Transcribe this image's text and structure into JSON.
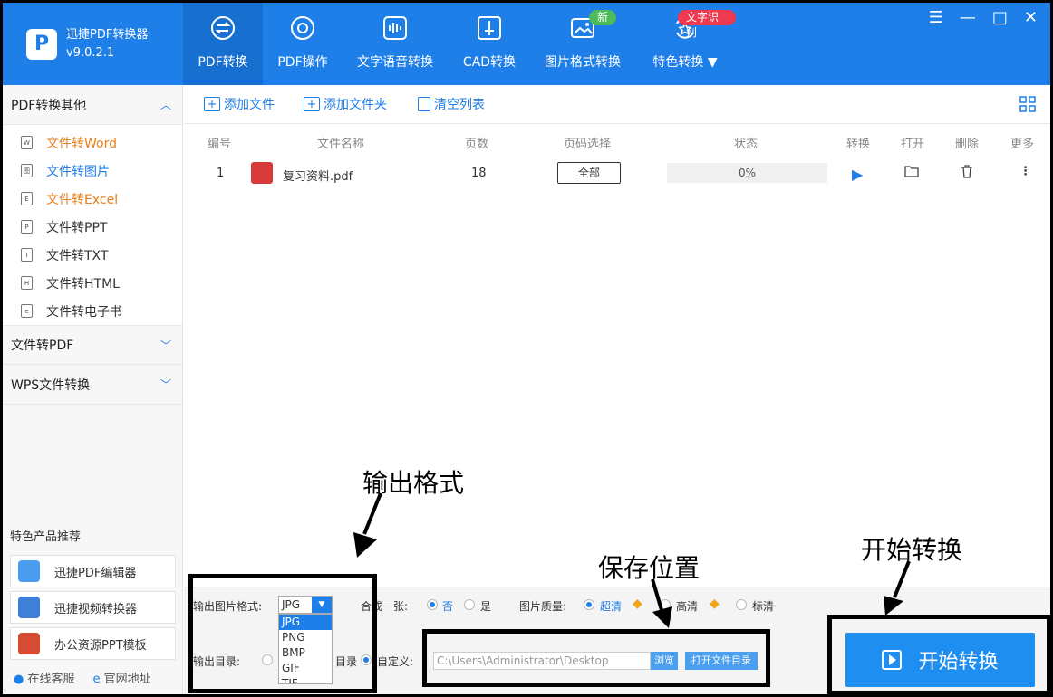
{
  "app": {
    "name": "迅捷PDF转换器",
    "version": "v9.0.2.1"
  },
  "nav": [
    {
      "label": "PDF转换",
      "icon": "pdf-convert-icon"
    },
    {
      "label": "PDF操作",
      "icon": "pdf-operate-icon"
    },
    {
      "label": "文字语音转换",
      "icon": "voice-wave-icon"
    },
    {
      "label": "CAD转换",
      "icon": "cad-icon"
    },
    {
      "label": "图片格式转换",
      "icon": "image-icon"
    },
    {
      "label": "特色转换",
      "icon": "star-convert-icon"
    }
  ],
  "badges": {
    "new": "新",
    "ocr": "文字识别"
  },
  "window_controls": {
    "menu": "☰",
    "minimize": "—",
    "maximize": "□",
    "close": "✕"
  },
  "sidebar": {
    "section1": "PDF转换其他",
    "items": [
      "文件转Word",
      "文件转图片",
      "文件转Excel",
      "文件转PPT",
      "文件转TXT",
      "文件转HTML",
      "文件转电子书"
    ],
    "item_icons": [
      "W",
      "图",
      "E",
      "P",
      "T",
      "H",
      "e"
    ],
    "section2": "文件转PDF",
    "section3": "WPS文件转换",
    "promo_title": "特色产品推荐",
    "promos": [
      "迅捷PDF编辑器",
      "迅捷视频转换器",
      "办公资源PPT模板"
    ],
    "footer": [
      "在线客服",
      "官网地址"
    ]
  },
  "toolbar": {
    "add_file": "添加文件",
    "add_folder": "添加文件夹",
    "clear": "清空列表"
  },
  "table": {
    "headers": [
      "编号",
      "文件名称",
      "页数",
      "页码选择",
      "状态",
      "转换",
      "打开",
      "删除",
      "更多"
    ],
    "rows": [
      {
        "index": "1",
        "name": "复习资料.pdf",
        "pages": "18",
        "page_select": "全部",
        "status": "0%"
      }
    ]
  },
  "settings": {
    "format_label": "输出图片格式:",
    "format_value": "JPG",
    "format_options": [
      "JPG",
      "PNG",
      "BMP",
      "GIF",
      "TIF"
    ],
    "merge_label": "合成一张:",
    "merge_no": "否",
    "merge_yes": "是",
    "quality_label": "图片质量:",
    "quality_options": [
      "超清",
      "高清",
      "标清"
    ],
    "output_dir_label": "输出目录:",
    "orig_dir_suffix": "目录",
    "custom_label": "自定义:",
    "path": "C:\\Users\\Administrator\\Desktop",
    "browse": "浏览",
    "open_dir": "打开文件目录"
  },
  "start_button": "开始转换",
  "annotations": {
    "format": "输出格式",
    "location": "保存位置",
    "start": "开始转换"
  },
  "colors": {
    "brand": "#1e7fe9",
    "accent_orange": "#e8801c",
    "badge_new": "#4cbb5b",
    "badge_ocr": "#f0384f"
  }
}
